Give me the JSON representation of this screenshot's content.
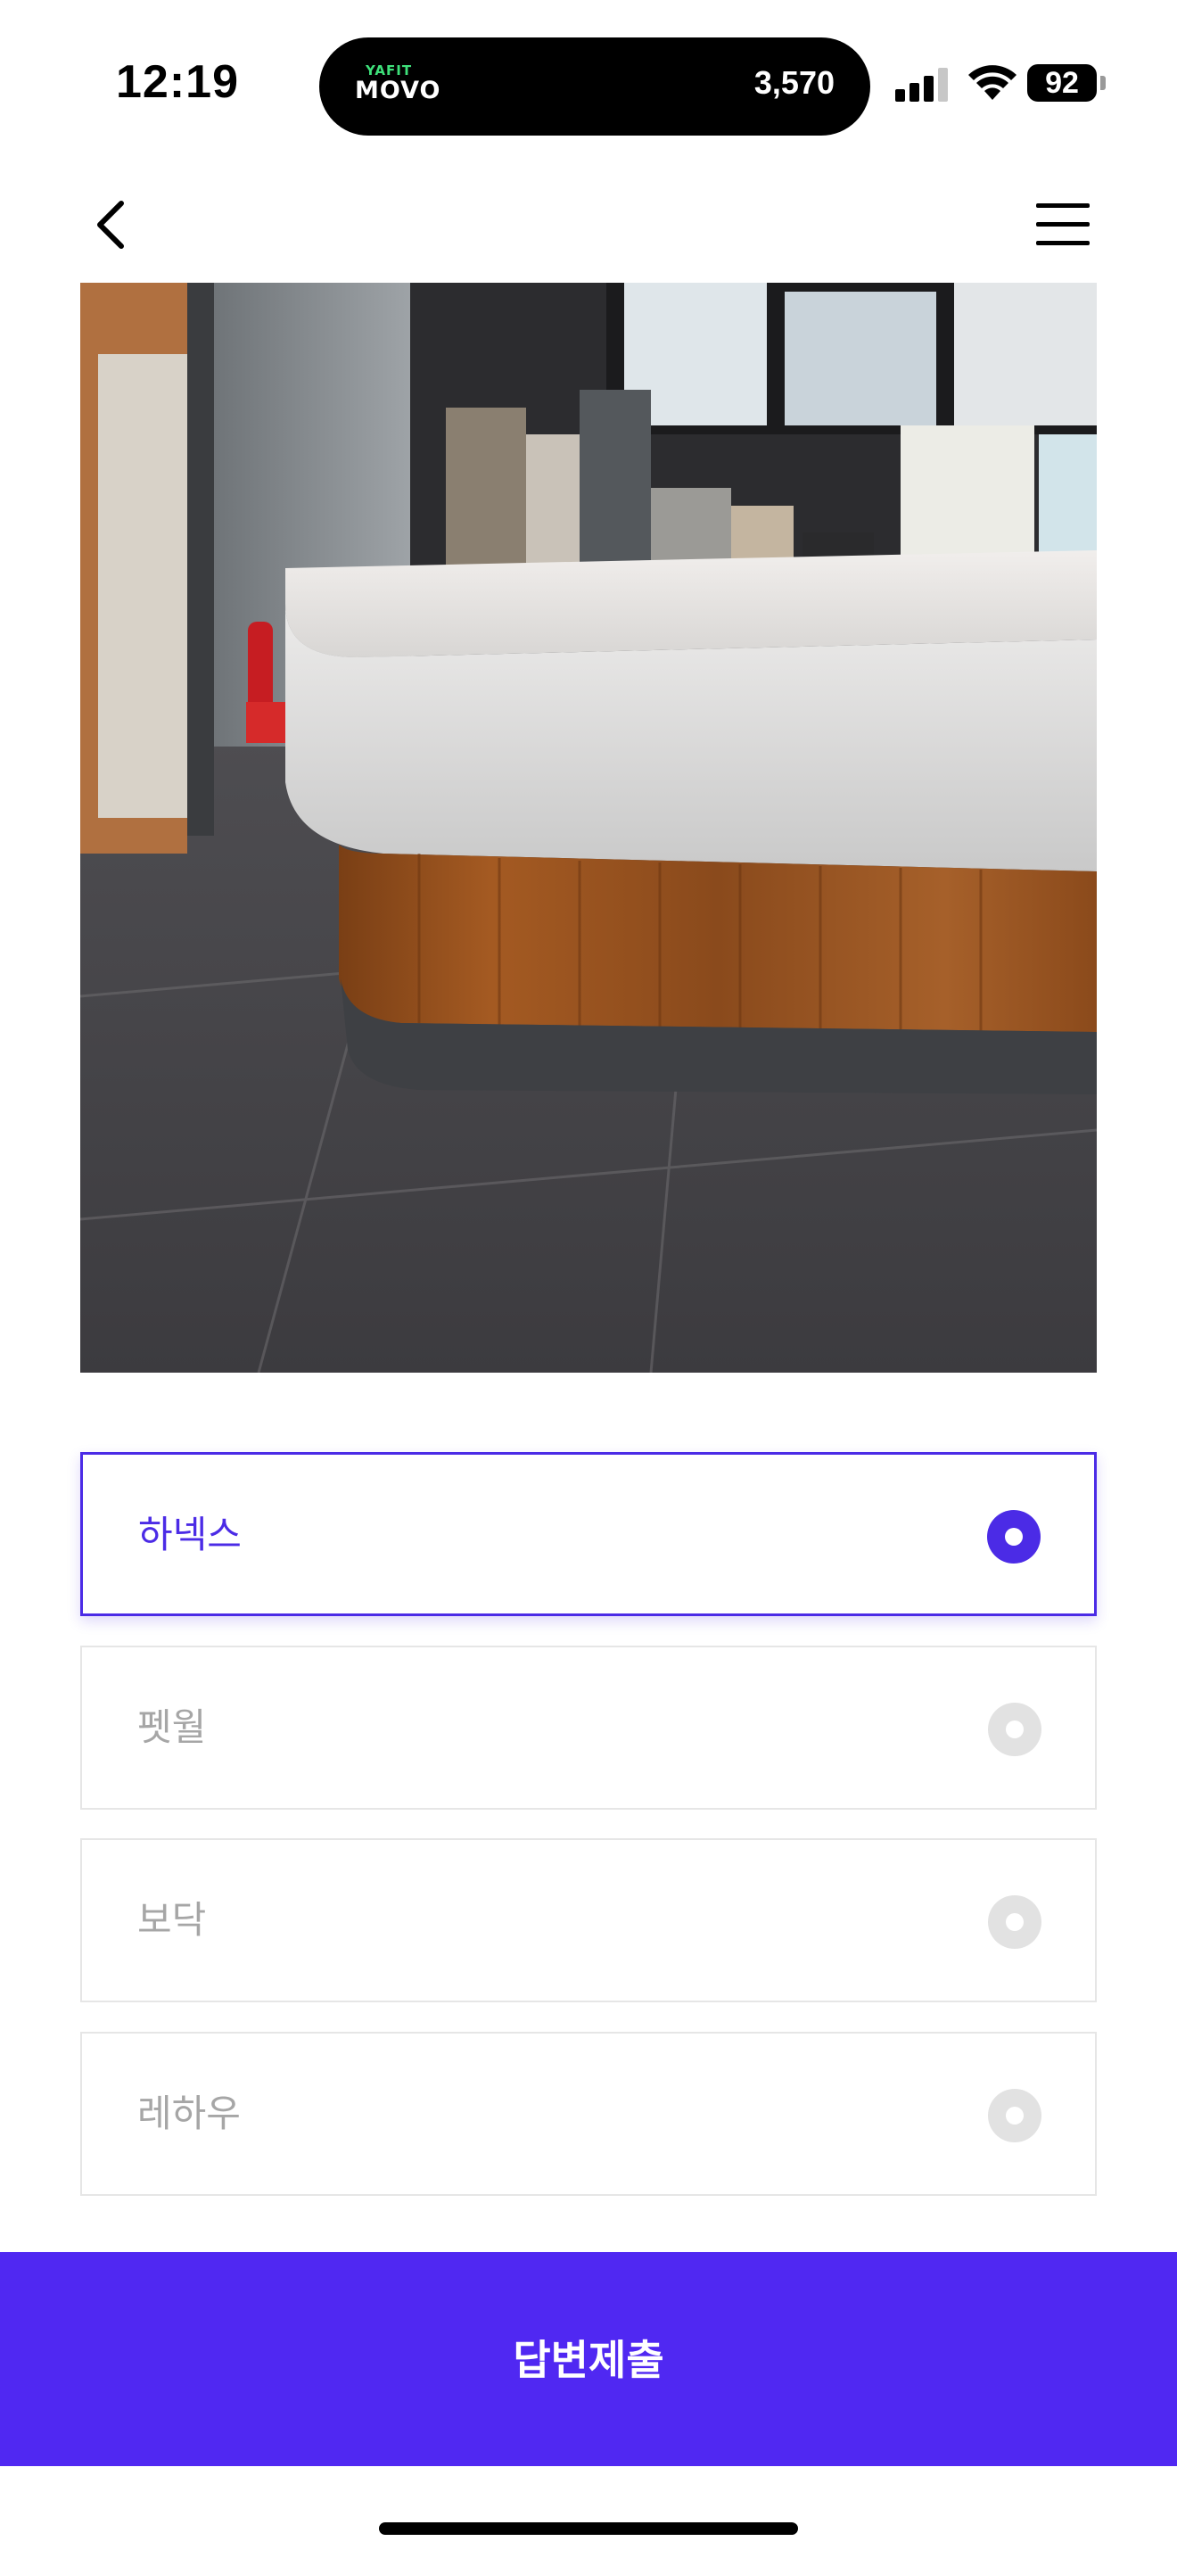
{
  "status_bar": {
    "time": "12:19",
    "island_brand_top": "YAFIT",
    "island_brand_main": "MOVO",
    "island_count": "3,570",
    "battery_level": "92",
    "signal_bars_filled": 3,
    "signal_bars_total": 4
  },
  "nav": {
    "back_icon": "chevron-left-icon",
    "menu_icon": "hamburger-menu-icon"
  },
  "photo": {
    "subject": "cafe-counter-photo"
  },
  "options": [
    {
      "label": "하넥스",
      "selected": true
    },
    {
      "label": "펫월",
      "selected": false
    },
    {
      "label": "보닥",
      "selected": false
    },
    {
      "label": "레하우",
      "selected": false
    }
  ],
  "submit": {
    "label": "답변제출"
  },
  "colors": {
    "accent": "#4b2be6",
    "submit_background": "#5028f2",
    "unselected_text": "#a6a6a6",
    "unselected_radio": "#e2e2e2"
  }
}
